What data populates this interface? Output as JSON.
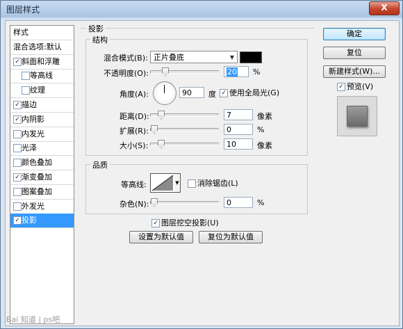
{
  "window": {
    "title": "图层样式",
    "close_label": "X"
  },
  "sidebar": {
    "items": [
      {
        "label": "样式",
        "checkbox": false,
        "checked": false,
        "sub": false,
        "selected": false
      },
      {
        "label": "混合选项:默认",
        "checkbox": false,
        "checked": false,
        "sub": false,
        "selected": false
      },
      {
        "label": "斜面和浮雕",
        "checkbox": true,
        "checked": true,
        "sub": false,
        "selected": false
      },
      {
        "label": "等高线",
        "checkbox": true,
        "checked": false,
        "sub": true,
        "selected": false
      },
      {
        "label": "纹理",
        "checkbox": true,
        "checked": false,
        "sub": true,
        "selected": false
      },
      {
        "label": "描边",
        "checkbox": true,
        "checked": true,
        "sub": false,
        "selected": false
      },
      {
        "label": "内阴影",
        "checkbox": true,
        "checked": true,
        "sub": false,
        "selected": false
      },
      {
        "label": "内发光",
        "checkbox": true,
        "checked": false,
        "sub": false,
        "selected": false
      },
      {
        "label": "光泽",
        "checkbox": true,
        "checked": false,
        "sub": false,
        "selected": false
      },
      {
        "label": "颜色叠加",
        "checkbox": true,
        "checked": false,
        "sub": false,
        "selected": false
      },
      {
        "label": "渐变叠加",
        "checkbox": true,
        "checked": true,
        "sub": false,
        "selected": false
      },
      {
        "label": "图案叠加",
        "checkbox": true,
        "checked": false,
        "sub": false,
        "selected": false
      },
      {
        "label": "外发光",
        "checkbox": true,
        "checked": false,
        "sub": false,
        "selected": false
      },
      {
        "label": "投影",
        "checkbox": true,
        "checked": true,
        "sub": false,
        "selected": true
      }
    ]
  },
  "drop_shadow": {
    "section_title": "投影",
    "structure": {
      "title": "结构",
      "blend_mode_label": "混合模式(B):",
      "blend_mode_value": "正片叠底",
      "blend_color": "#000000",
      "opacity_label": "不透明度(O):",
      "opacity_value": "20",
      "opacity_unit": "%",
      "angle_label": "角度(A):",
      "angle_value": "90",
      "angle_unit": "度",
      "global_light_label": "使用全局光(G)",
      "global_light_checked": true,
      "distance_label": "距离(D):",
      "distance_value": "7",
      "distance_unit": "像素",
      "spread_label": "扩展(R):",
      "spread_value": "0",
      "spread_unit": "%",
      "size_label": "大小(S):",
      "size_value": "10",
      "size_unit": "像素"
    },
    "quality": {
      "title": "品质",
      "contour_label": "等高线:",
      "anti_alias_label": "消除锯齿(L)",
      "anti_alias_checked": false,
      "noise_label": "杂色(N):",
      "noise_value": "0",
      "noise_unit": "%"
    },
    "knockout_label": "图层挖空投影(U)",
    "knockout_checked": true,
    "make_default_label": "设置为默认值",
    "reset_default_label": "复位为默认值"
  },
  "buttons": {
    "ok": "确定",
    "reset": "复位",
    "new_style": "新建样式(W)...",
    "preview_label": "预览(V)",
    "preview_checked": true
  },
  "check_mark": "✓",
  "dropdown_arrow": "▼",
  "watermark": "Bai 知道 | ps吧"
}
